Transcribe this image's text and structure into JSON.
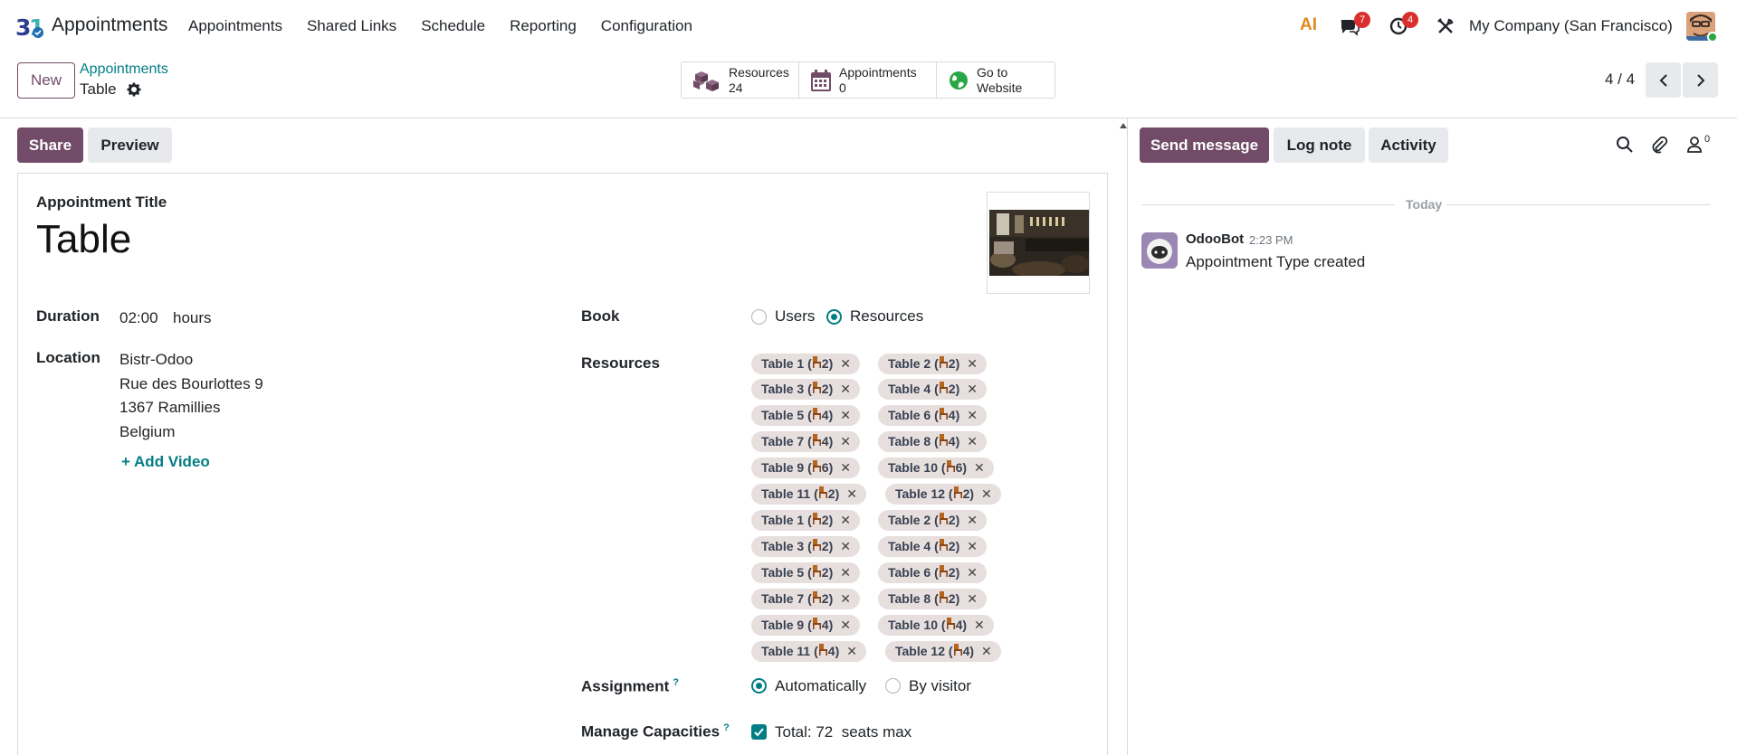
{
  "navbar": {
    "app_name": "Appointments",
    "menu": [
      "Appointments",
      "Shared Links",
      "Schedule",
      "Reporting",
      "Configuration"
    ],
    "ai_label": "AI",
    "messages_count": "7",
    "activities_count": "4",
    "company": "My Company (San Francisco)"
  },
  "control": {
    "new_label": "New",
    "breadcrumb": "Appointments",
    "current": "Table",
    "smart_buttons": [
      {
        "label": "Resources",
        "value": "24"
      },
      {
        "label": "Appointments",
        "value": "0"
      },
      {
        "label": "Go to",
        "value": "Website"
      }
    ],
    "pager": "4 / 4"
  },
  "form": {
    "share_label": "Share",
    "preview_label": "Preview",
    "title_label": "Appointment Title",
    "title_value": "Table",
    "duration_label": "Duration",
    "duration_value": "02:00",
    "duration_unit": "hours",
    "location_label": "Location",
    "location_lines": [
      "Bistr-Odoo",
      "Rue des Bourlottes 9",
      "1367 Ramillies",
      "Belgium"
    ],
    "add_video": "Add Video",
    "book_label": "Book",
    "book_options": [
      "Users",
      "Resources"
    ],
    "book_selected": "Resources",
    "resources_label": "Resources",
    "resources": [
      {
        "name": "Table 1",
        "cap": "2"
      },
      {
        "name": "Table 2",
        "cap": "2"
      },
      {
        "name": "Table 3",
        "cap": "2"
      },
      {
        "name": "Table 4",
        "cap": "2"
      },
      {
        "name": "Table 5",
        "cap": "4"
      },
      {
        "name": "Table 6",
        "cap": "4"
      },
      {
        "name": "Table 7",
        "cap": "4"
      },
      {
        "name": "Table 8",
        "cap": "4"
      },
      {
        "name": "Table 9",
        "cap": "6"
      },
      {
        "name": "Table 10",
        "cap": "6"
      },
      {
        "name": "Table 11",
        "cap": "2"
      },
      {
        "name": "Table 12",
        "cap": "2"
      },
      {
        "name": "Table 1",
        "cap": "2"
      },
      {
        "name": "Table 2",
        "cap": "2"
      },
      {
        "name": "Table 3",
        "cap": "2"
      },
      {
        "name": "Table 4",
        "cap": "2"
      },
      {
        "name": "Table 5",
        "cap": "2"
      },
      {
        "name": "Table 6",
        "cap": "2"
      },
      {
        "name": "Table 7",
        "cap": "2"
      },
      {
        "name": "Table 8",
        "cap": "2"
      },
      {
        "name": "Table 9",
        "cap": "4"
      },
      {
        "name": "Table 10",
        "cap": "4"
      },
      {
        "name": "Table 11",
        "cap": "4"
      },
      {
        "name": "Table 12",
        "cap": "4"
      }
    ],
    "assignment_label": "Assignment",
    "assignment_options": [
      "Automatically",
      "By visitor"
    ],
    "assignment_selected": "Automatically",
    "capacities_label": "Manage Capacities",
    "capacities_value": "Total: 72  seats max",
    "help_mark": "?"
  },
  "chatter": {
    "send_label": "Send message",
    "log_label": "Log note",
    "activity_label": "Activity",
    "followers": "0",
    "today": "Today",
    "author": "OdooBot",
    "time": "2:23 PM",
    "message": "Appointment Type created"
  },
  "colors": {
    "primary": "#714b67",
    "link": "#017e84",
    "badge": "#d9302f"
  }
}
